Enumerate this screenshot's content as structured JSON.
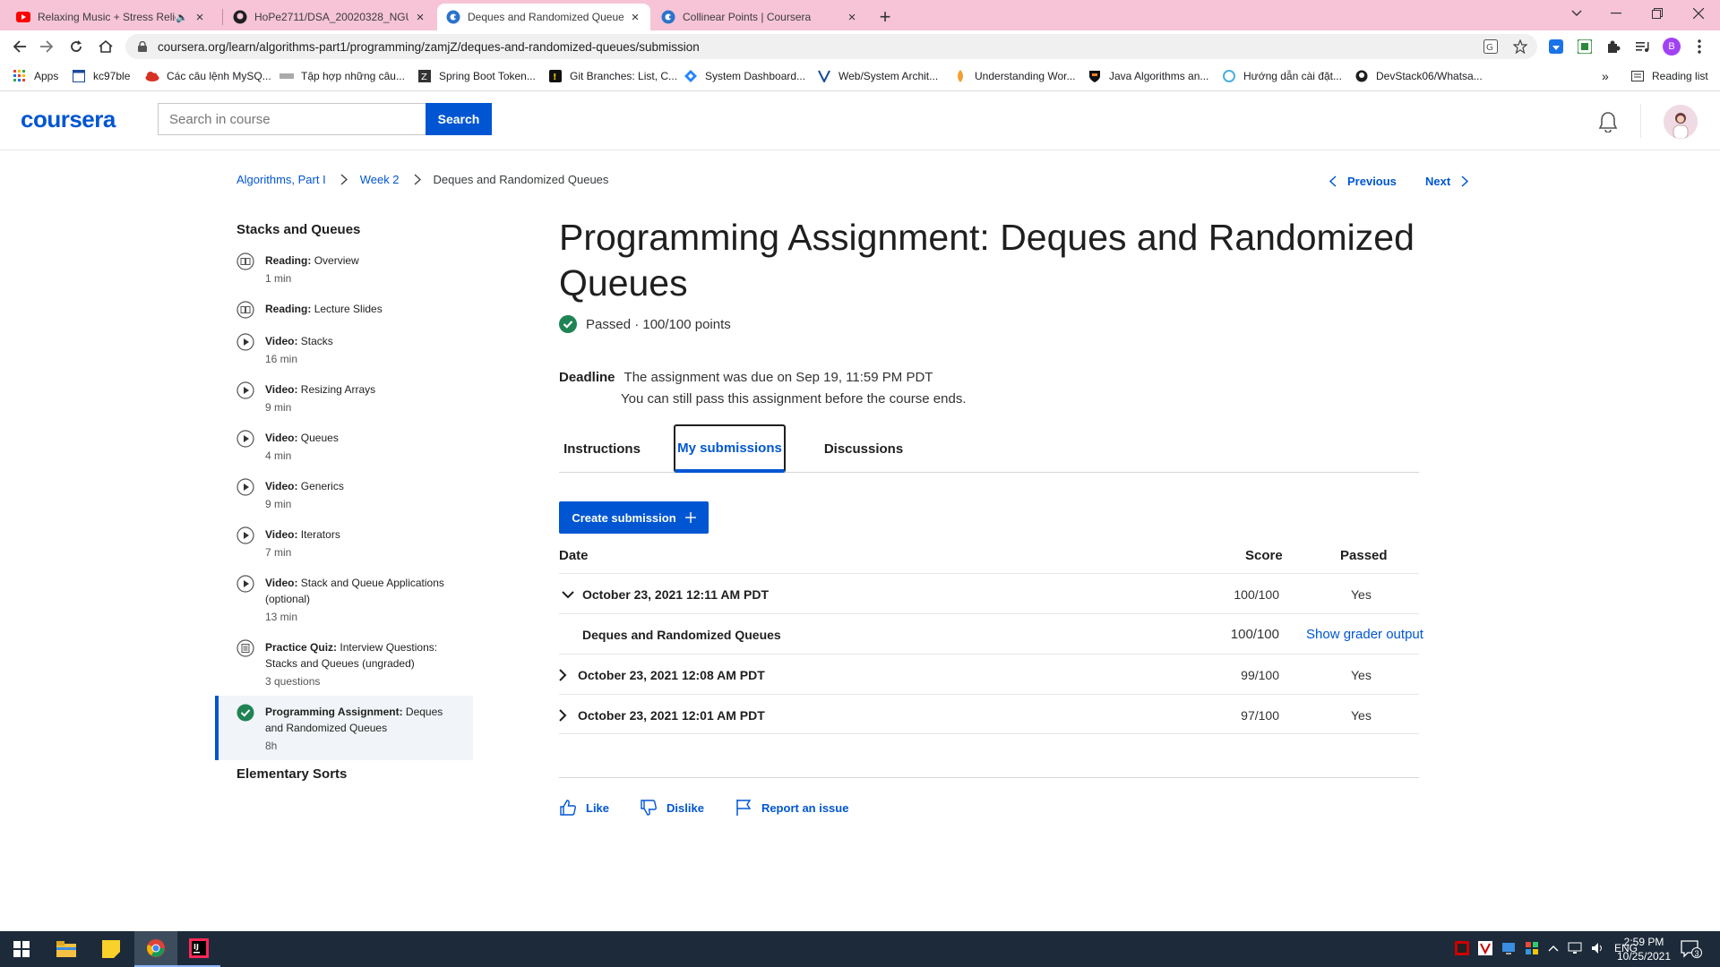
{
  "browser": {
    "tabs": [
      {
        "title": "Relaxing Music + Stress Relie",
        "icon": "youtube-icon"
      },
      {
        "title": "HoPe2711/DSA_20020328_NGUY",
        "icon": "github-icon"
      },
      {
        "title": "Deques and Randomized Queue",
        "icon": "coursera-icon",
        "active": true
      },
      {
        "title": "Collinear Points | Coursera",
        "icon": "coursera-icon"
      }
    ],
    "url": "coursera.org/learn/algorithms-part1/programming/zamjZ/deques-and-randomized-queues/submission",
    "profile_initial": "B",
    "bookmarks": [
      "Apps",
      "kc97ble",
      "Các câu lệnh MySQ...",
      "Tập hợp những câu...",
      "Spring Boot Token...",
      "Git Branches: List, C...",
      "System Dashboard...",
      "Web/System Archit...",
      "Understanding Wor...",
      "Java Algorithms an...",
      "Hướng dẫn cài đặt...",
      "DevStack06/Whatsa..."
    ],
    "reading_list": "Reading list",
    "more": "»"
  },
  "header": {
    "logo": "coursera",
    "search_placeholder": "Search in course",
    "search_button": "Search"
  },
  "breadcrumb": [
    "Algorithms, Part I",
    "Week 2",
    "Deques and Randomized Queues"
  ],
  "nav": {
    "previous": "Previous",
    "next": "Next"
  },
  "sidebar": {
    "section_title": "Stacks and Queues",
    "items": [
      {
        "type": "Reading:",
        "title": "Overview",
        "duration": "1 min",
        "icon": "book-icon"
      },
      {
        "type": "Reading:",
        "title": "Lecture Slides",
        "duration": "",
        "icon": "book-icon"
      },
      {
        "type": "Video:",
        "title": "Stacks",
        "duration": "16 min",
        "icon": "play-icon"
      },
      {
        "type": "Video:",
        "title": "Resizing Arrays",
        "duration": "9 min",
        "icon": "play-icon"
      },
      {
        "type": "Video:",
        "title": "Queues",
        "duration": "4 min",
        "icon": "play-icon"
      },
      {
        "type": "Video:",
        "title": "Generics",
        "duration": "9 min",
        "icon": "play-icon"
      },
      {
        "type": "Video:",
        "title": "Iterators",
        "duration": "7 min",
        "icon": "play-icon"
      },
      {
        "type": "Video:",
        "title": "Stack and Queue Applications (optional)",
        "duration": "13 min",
        "icon": "play-icon"
      },
      {
        "type": "Practice Quiz:",
        "title": "Interview Questions: Stacks and Queues (ungraded)",
        "duration": "3 questions",
        "icon": "quiz-icon"
      },
      {
        "type": "Programming Assignment:",
        "title": "Deques and Randomized Queues",
        "duration": "8h",
        "icon": "check-circle-icon"
      }
    ],
    "next_section_title": "Elementary Sorts"
  },
  "main": {
    "title": "Programming Assignment: Deques and Randomized Queues",
    "status": "Passed · 100/100 points",
    "deadline_label": "Deadline",
    "deadline_line1": "The assignment was due on Sep 19, 11:59 PM PDT",
    "deadline_line2": "You can still pass this assignment before the course ends.",
    "tabs": [
      "Instructions",
      "My submissions",
      "Discussions"
    ],
    "create_submission": "Create submission",
    "table": {
      "headers": [
        "Date",
        "Score",
        "Passed"
      ],
      "rows": [
        {
          "date": "October 23, 2021 12:11 AM PDT",
          "score": "100/100",
          "passed": "Yes",
          "expanded": true
        },
        {
          "date": "Deques and Randomized Queues",
          "score": "100/100",
          "link": "Show grader output"
        },
        {
          "date": "October 23, 2021 12:08 AM PDT",
          "score": "99/100",
          "passed": "Yes"
        },
        {
          "date": "October 23, 2021 12:01 AM PDT",
          "score": "97/100",
          "passed": "Yes"
        }
      ]
    },
    "feedback": {
      "like": "Like",
      "dislike": "Dislike",
      "report": "Report an issue"
    }
  },
  "taskbar": {
    "lang": "ENG",
    "time": "2:59 PM",
    "date": "10/25/2021",
    "notifications": "3"
  },
  "colors": {
    "brand": "#0056d2",
    "success": "#1f8354",
    "tabstrip": "#f6c4d6",
    "taskbar": "#1c2a3a"
  }
}
